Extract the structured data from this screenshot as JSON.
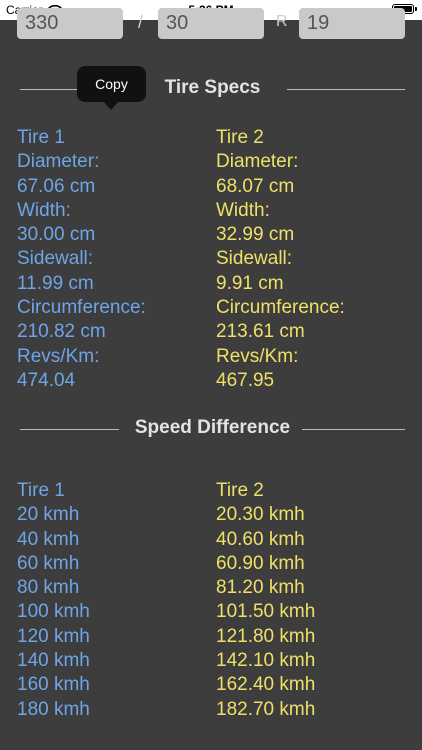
{
  "status": {
    "carrier": "Carrier",
    "time": "5:36 PM"
  },
  "inputs": {
    "width": "330",
    "separator1": "/",
    "aspect": "30",
    "separator2": "R",
    "rim": "19"
  },
  "tooltip": {
    "label": "Copy"
  },
  "tire_specs": {
    "title": "Tire Specs",
    "tire1": {
      "header": "Tire 1",
      "diameter_label": "Diameter:",
      "diameter": "67.06 cm",
      "width_label": "Width:",
      "width": "30.00 cm",
      "sidewall_label": "Sidewall:",
      "sidewall": "11.99 cm",
      "circumference_label": "Circumference:",
      "circumference": "210.82 cm",
      "revs_label": "Revs/Km:",
      "revs": "474.04"
    },
    "tire2": {
      "header": "Tire 2",
      "diameter_label": "Diameter:",
      "diameter": "68.07 cm",
      "width_label": "Width:",
      "width": "32.99 cm",
      "sidewall_label": "Sidewall:",
      "sidewall": "9.91 cm",
      "circumference_label": "Circumference:",
      "circumference": "213.61 cm",
      "revs_label": "Revs/Km:",
      "revs": "467.95"
    }
  },
  "speed_difference": {
    "title": "Speed Difference",
    "tire1_header": "Tire 1",
    "tire2_header": "Tire 2",
    "tire1_speeds": [
      "20 kmh",
      "40 kmh",
      "60 kmh",
      "80 kmh",
      "100 kmh",
      "120 kmh",
      "140 kmh",
      "160 kmh",
      "180 kmh"
    ],
    "tire2_speeds": [
      "20.30 kmh",
      "40.60 kmh",
      "60.90 kmh",
      "81.20 kmh",
      "101.50 kmh",
      "121.80 kmh",
      "142.10 kmh",
      "162.40 kmh",
      "182.70 kmh"
    ]
  },
  "colors": {
    "background": "#3d3d3d",
    "tire1_text": "#6fa4e6",
    "tire2_text": "#eee066",
    "input_bg": "#c9c9c9"
  }
}
